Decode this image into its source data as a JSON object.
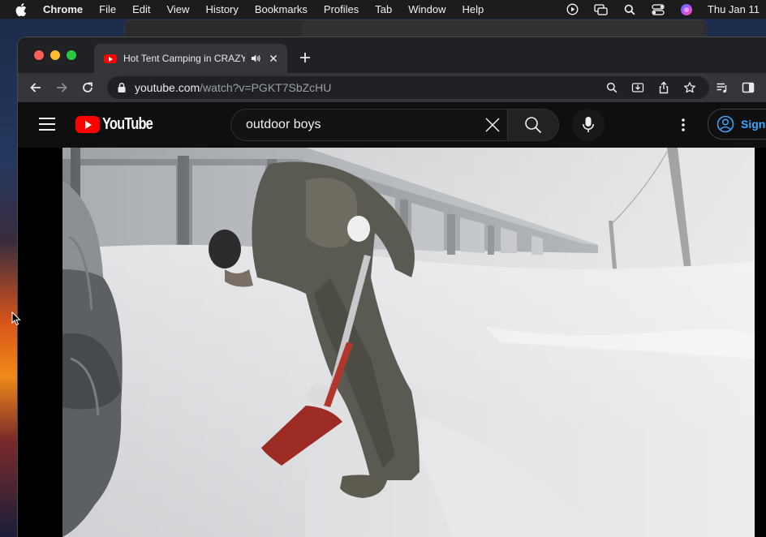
{
  "menubar": {
    "app_name": "Chrome",
    "items": [
      "File",
      "Edit",
      "View",
      "History",
      "Bookmarks",
      "Profiles",
      "Tab",
      "Window",
      "Help"
    ],
    "clock": "Thu Jan 11"
  },
  "browser": {
    "tab_title": "Hot Tent Camping in CRAZY",
    "url_host": "youtube.com",
    "url_path": "/watch?v=PGKT7SbZcHU"
  },
  "youtube": {
    "logo_text": "YouTube",
    "search_value": "outdoor boys",
    "signin_label": "Sign in"
  },
  "colors": {
    "youtube_red": "#ff0000",
    "signin_blue": "#3ea6ff",
    "chrome_dark": "#35363a"
  }
}
